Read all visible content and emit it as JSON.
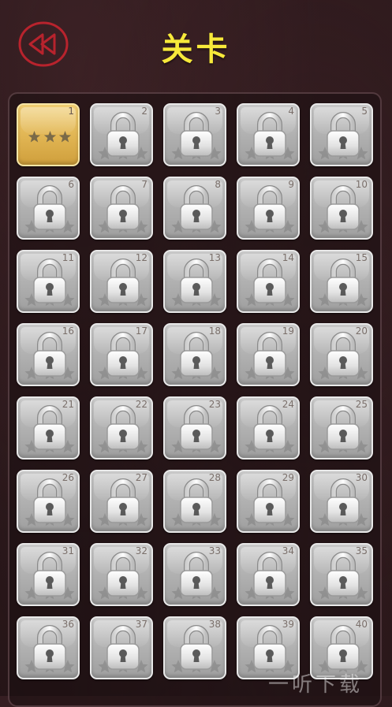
{
  "header": {
    "title": "关卡",
    "back_icon": "rewind-icon",
    "accent_color": "#f7e93a",
    "back_button_color": "#b8232d"
  },
  "levels": [
    {
      "number": "1",
      "state": "unlocked",
      "stars": 3
    },
    {
      "number": "2",
      "state": "locked"
    },
    {
      "number": "3",
      "state": "locked"
    },
    {
      "number": "4",
      "state": "locked"
    },
    {
      "number": "5",
      "state": "locked"
    },
    {
      "number": "6",
      "state": "locked"
    },
    {
      "number": "7",
      "state": "locked"
    },
    {
      "number": "8",
      "state": "locked"
    },
    {
      "number": "9",
      "state": "locked"
    },
    {
      "number": "10",
      "state": "locked"
    },
    {
      "number": "11",
      "state": "locked"
    },
    {
      "number": "12",
      "state": "locked"
    },
    {
      "number": "13",
      "state": "locked"
    },
    {
      "number": "14",
      "state": "locked"
    },
    {
      "number": "15",
      "state": "locked"
    },
    {
      "number": "16",
      "state": "locked"
    },
    {
      "number": "17",
      "state": "locked"
    },
    {
      "number": "18",
      "state": "locked"
    },
    {
      "number": "19",
      "state": "locked"
    },
    {
      "number": "20",
      "state": "locked"
    },
    {
      "number": "21",
      "state": "locked"
    },
    {
      "number": "22",
      "state": "locked"
    },
    {
      "number": "23",
      "state": "locked"
    },
    {
      "number": "24",
      "state": "locked"
    },
    {
      "number": "25",
      "state": "locked"
    },
    {
      "number": "26",
      "state": "locked"
    },
    {
      "number": "27",
      "state": "locked"
    },
    {
      "number": "28",
      "state": "locked"
    },
    {
      "number": "29",
      "state": "locked"
    },
    {
      "number": "30",
      "state": "locked"
    },
    {
      "number": "31",
      "state": "locked"
    },
    {
      "number": "32",
      "state": "locked"
    },
    {
      "number": "33",
      "state": "locked"
    },
    {
      "number": "34",
      "state": "locked"
    },
    {
      "number": "35",
      "state": "locked"
    },
    {
      "number": "36",
      "state": "locked"
    },
    {
      "number": "37",
      "state": "locked"
    },
    {
      "number": "38",
      "state": "locked"
    },
    {
      "number": "39",
      "state": "locked"
    },
    {
      "number": "40",
      "state": "locked"
    }
  ],
  "colors": {
    "locked_tile": "#b1b1b1",
    "unlocked_tile": "#e0b452",
    "star_earned": "#7a6a48",
    "lock_metal": "#e6e6e6"
  },
  "watermark": {
    "text": "一听下载"
  }
}
